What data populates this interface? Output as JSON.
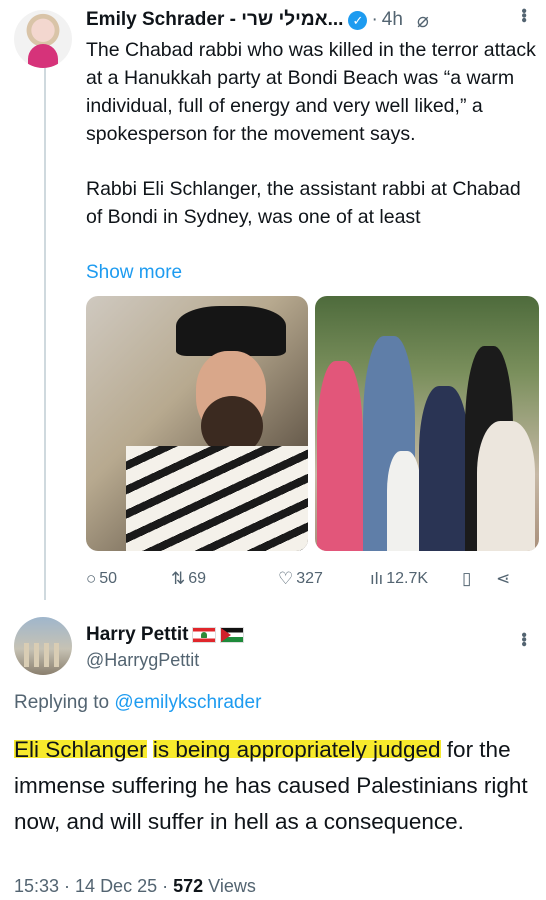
{
  "post": {
    "author_name": "Emily Schrader - אמילי שרי...",
    "time": "4h",
    "paragraph1": "The Chabad rabbi who was killed in the terror attack at a Hanukkah party at Bondi Beach was “a warm individual, full of energy and very well liked,” a spokesperson for the movement says.",
    "paragraph2": "Rabbi Eli Schlanger, the assistant rabbi at Chabad of Bondi in Sydney, was one of at least",
    "show_more": "Show more",
    "stats": {
      "replies": "50",
      "reposts": "69",
      "likes": "327",
      "views": "12.7K"
    },
    "icons": [
      "verified-badge",
      "grok-icon",
      "more-icon",
      "reply-icon",
      "repost-icon",
      "like-icon",
      "views-icon",
      "bookmark-icon",
      "share-icon"
    ]
  },
  "reply": {
    "display_name": "Harry Pettit",
    "flags": [
      "lebanon-flag",
      "palestine-flag"
    ],
    "handle": "@HarrygPettit",
    "replying_label": "Replying to",
    "replying_to": "@emilykschrader",
    "text_part1": "Eli Schlanger",
    "text_part2": " ",
    "text_part3": "is being appropriately judged",
    "text_part4": " for the immense suffering he has caused Palestinians right now, and will suffer in hell as a consequence.",
    "timestamp": "15:33 · 14 Dec 25 · ",
    "views_count": "572",
    "views_label": " Views"
  },
  "colors": {
    "link": "#1d9bf0",
    "muted": "#536471",
    "highlight": "#f7ea2c"
  }
}
